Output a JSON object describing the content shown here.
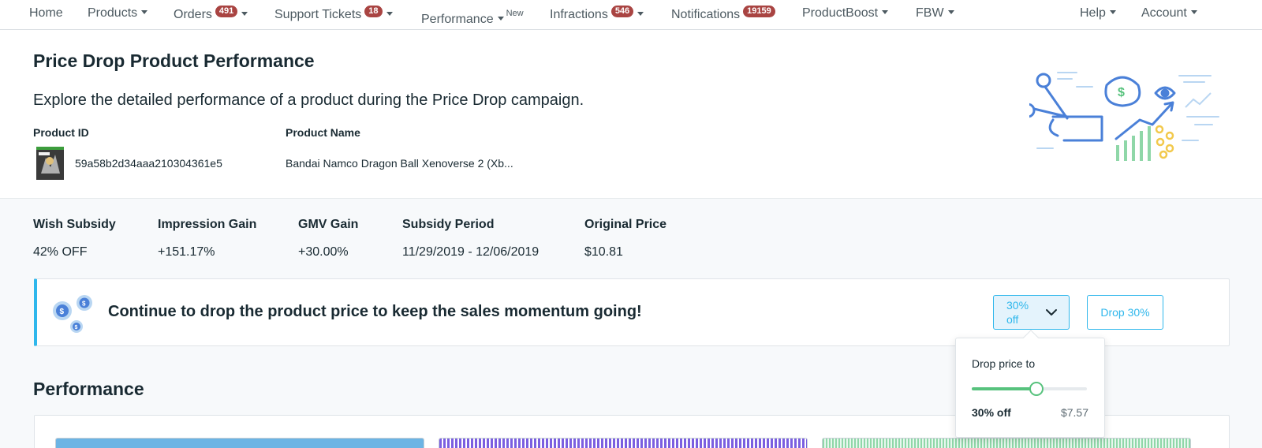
{
  "nav": {
    "items": [
      {
        "label": "Home"
      },
      {
        "label": "Products"
      },
      {
        "label": "Orders",
        "badge": "491"
      },
      {
        "label": "Support Tickets",
        "badge": "18"
      },
      {
        "label": "Performance",
        "sup": "New"
      },
      {
        "label": "Infractions",
        "badge": "546"
      },
      {
        "label": "Notifications",
        "badge": "19159"
      },
      {
        "label": "ProductBoost"
      },
      {
        "label": "FBW"
      },
      {
        "label": "Help"
      },
      {
        "label": "Account"
      }
    ]
  },
  "header": {
    "title": "Price Drop Product Performance",
    "subtitle": "Explore the detailed performance of a product during the Price Drop campaign.",
    "product_id_label": "Product ID",
    "product_name_label": "Product Name",
    "product_id": "59a58b2d34aaa210304361e5",
    "product_name": "Bandai Namco Dragon Ball Xenoverse 2 (Xb..."
  },
  "stats": [
    {
      "label": "Wish Subsidy",
      "value": "42% OFF"
    },
    {
      "label": "Impression Gain",
      "value": "+151.17%"
    },
    {
      "label": "GMV Gain",
      "value": "+30.00%"
    },
    {
      "label": "Subsidy Period",
      "value": "11/29/2019 - 12/06/2019"
    },
    {
      "label": "Original Price",
      "value": "$10.81"
    }
  ],
  "banner": {
    "text": "Continue to drop the product price to keep the sales momentum going!",
    "select_value": "30% off",
    "drop_button": "Drop 30%"
  },
  "popover": {
    "label": "Drop price to",
    "slider_fraction": 0.56,
    "percent": "30% off",
    "price": "$7.57"
  },
  "performance": {
    "title": "Performance"
  },
  "colors": {
    "accent": "#2fb7ec",
    "badge": "#a94442",
    "slider": "#57c27d",
    "card1": "#6cb4e4",
    "card2": "#7b5fe0",
    "card3": "#8fd7a8"
  }
}
